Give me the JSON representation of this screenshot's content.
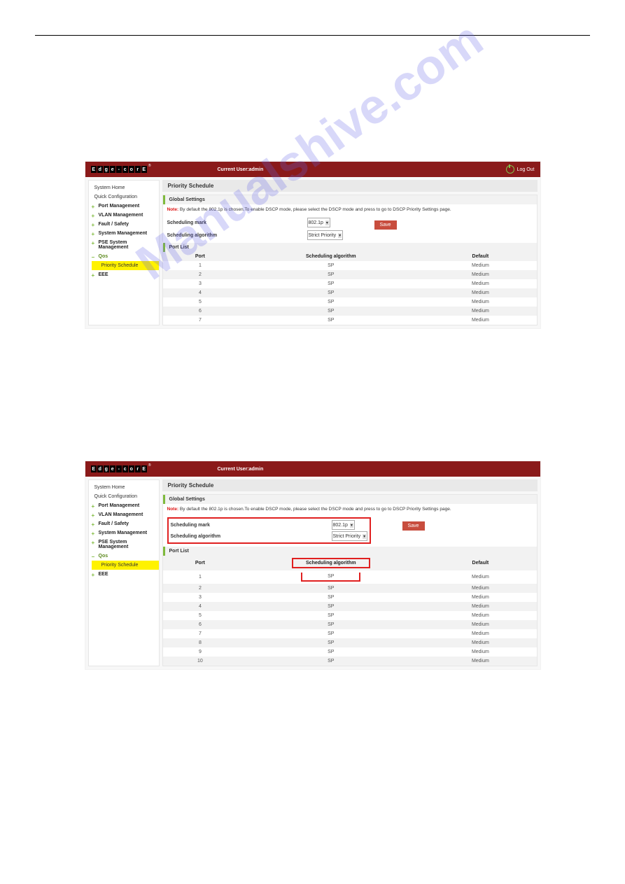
{
  "logo_chars": [
    "E",
    "d",
    "g",
    "e",
    "-",
    "c",
    "o",
    "r",
    "E"
  ],
  "header": {
    "current_user_label": "Current User:",
    "current_user_value": "admin",
    "logout": "Log Out"
  },
  "sidebar": {
    "home": "System Home",
    "quick": "Quick Configuration",
    "port_mgmt": "Port Management",
    "vlan_mgmt": "VLAN Management",
    "fault_safety": "Fault / Safety",
    "sys_mgmt": "System Management",
    "pse": "PSE System Management",
    "qos": "Qos",
    "priority_schedule": "Priority Schedule",
    "eee": "EEE"
  },
  "content1": {
    "title": "Priority Schedule",
    "global_settings": "Global Settings",
    "note_label": "Note:",
    "note_text": "By default the 802.1p is chosen.To enable DSCP mode, please select the DSCP mode and press to go to DSCP Priority Settings page.",
    "sched_mark_label": "Scheduling mark",
    "sched_mark_value": "802.1p",
    "sched_alg_label": "Scheduling algorithm",
    "sched_alg_value": "Strict Priority",
    "save": "Save",
    "port_list": "Port List",
    "cols": {
      "port": "Port",
      "alg": "Scheduling algorithm",
      "default": "Default"
    },
    "rows": [
      {
        "port": "1",
        "alg": "SP",
        "def": "Medium"
      },
      {
        "port": "2",
        "alg": "SP",
        "def": "Medium"
      },
      {
        "port": "3",
        "alg": "SP",
        "def": "Medium"
      },
      {
        "port": "4",
        "alg": "SP",
        "def": "Medium"
      },
      {
        "port": "5",
        "alg": "SP",
        "def": "Medium"
      },
      {
        "port": "6",
        "alg": "SP",
        "def": "Medium"
      },
      {
        "port": "7",
        "alg": "SP",
        "def": "Medium"
      }
    ]
  },
  "content2": {
    "title": "Priority Schedule",
    "global_settings": "Global Settings",
    "note_label": "Note:",
    "note_text": "By default the 802.1p is chosen.To enable DSCP mode, please select the DSCP mode and press to go to DSCP Priority Settings page.",
    "sched_mark_label": "Scheduling mark",
    "sched_mark_value": "802.1p",
    "sched_alg_label": "Scheduling algorithm",
    "sched_alg_value": "Strict Priority",
    "save": "Save",
    "port_list": "Port List",
    "cols": {
      "port": "Port",
      "alg": "Scheduling algorithm",
      "default": "Default"
    },
    "rows": [
      {
        "port": "1",
        "alg": "SP",
        "def": "Medium"
      },
      {
        "port": "2",
        "alg": "SP",
        "def": "Medium"
      },
      {
        "port": "3",
        "alg": "SP",
        "def": "Medium"
      },
      {
        "port": "4",
        "alg": "SP",
        "def": "Medium"
      },
      {
        "port": "5",
        "alg": "SP",
        "def": "Medium"
      },
      {
        "port": "6",
        "alg": "SP",
        "def": "Medium"
      },
      {
        "port": "7",
        "alg": "SP",
        "def": "Medium"
      },
      {
        "port": "8",
        "alg": "SP",
        "def": "Medium"
      },
      {
        "port": "9",
        "alg": "SP",
        "def": "Medium"
      },
      {
        "port": "10",
        "alg": "SP",
        "def": "Medium"
      }
    ]
  },
  "watermark_text": "Manualshive.com"
}
